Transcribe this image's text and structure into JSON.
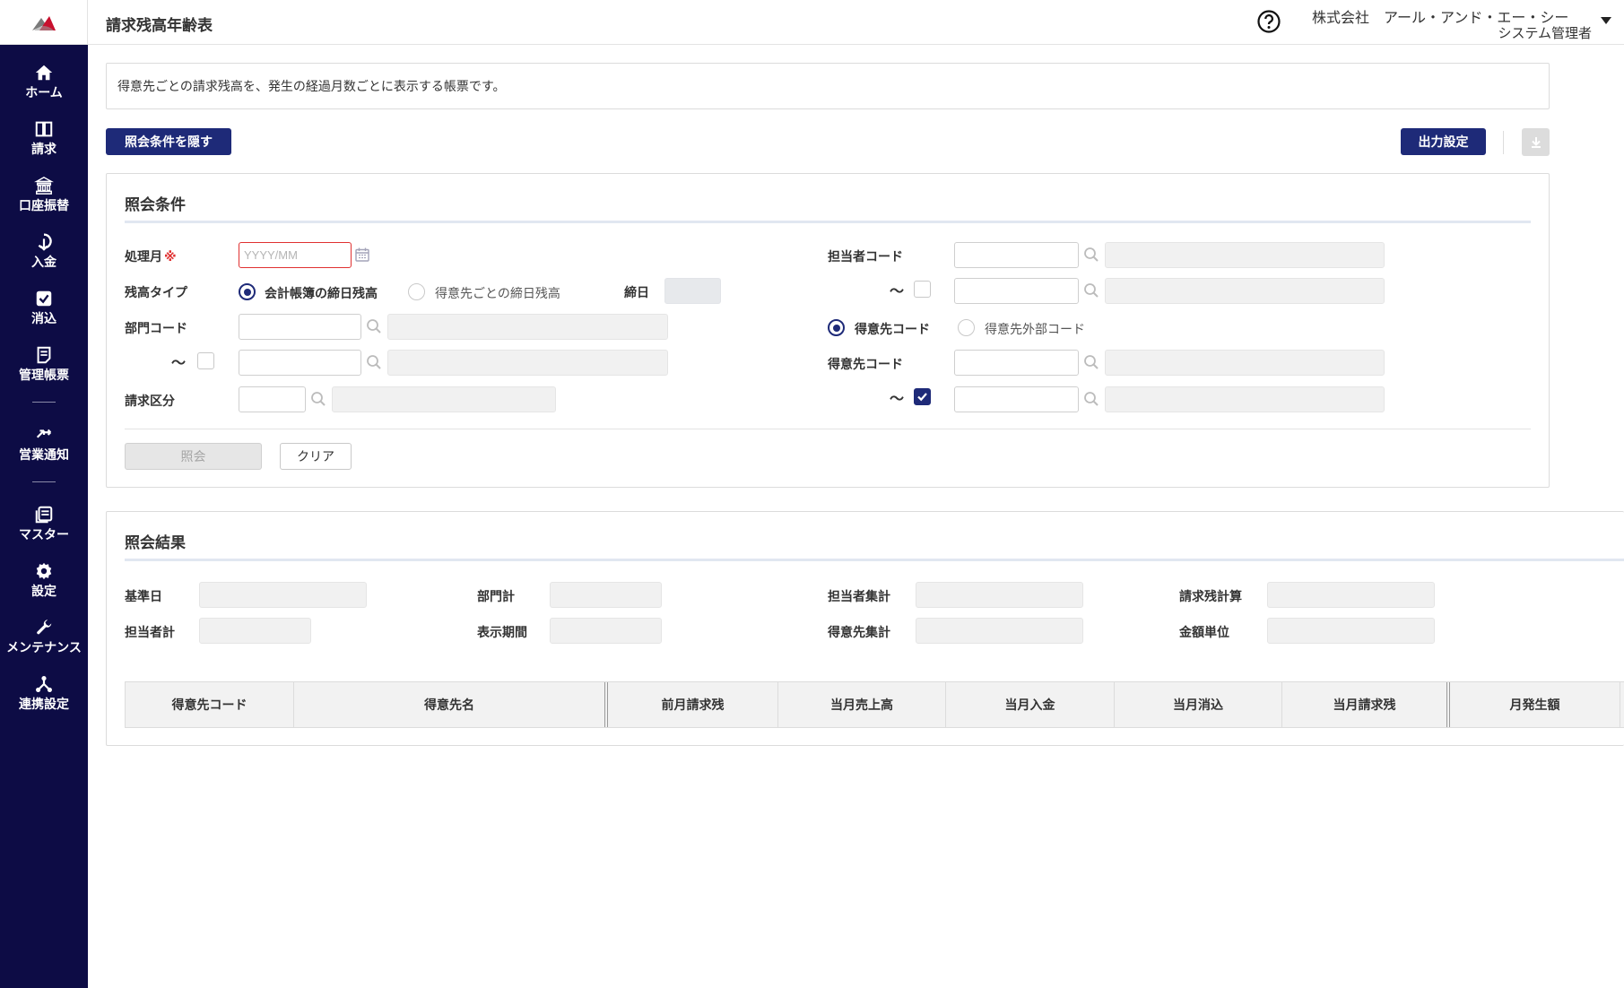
{
  "header": {
    "title": "請求残高年齢表",
    "company": "株式会社　アール・アンド・エー・シー",
    "user_role": "システム管理者"
  },
  "sidebar": {
    "items": [
      {
        "label": "ホーム",
        "icon": "home-icon"
      },
      {
        "label": "請求",
        "icon": "book-icon"
      },
      {
        "label": "口座振替",
        "icon": "bank-icon"
      },
      {
        "label": "入金",
        "icon": "deposit-icon"
      },
      {
        "label": "消込",
        "icon": "check-square-icon"
      },
      {
        "label": "管理帳票",
        "icon": "report-icon"
      },
      {
        "label": "営業通知",
        "icon": "arrows-exchange-icon"
      },
      {
        "label": "マスター",
        "icon": "master-list-icon"
      },
      {
        "label": "設定",
        "icon": "gear-icon"
      },
      {
        "label": "メンテナンス",
        "icon": "wrench-icon"
      },
      {
        "label": "連携設定",
        "icon": "network-icon"
      }
    ]
  },
  "description": "得意先ごとの請求残高を、発生の経過月数ごとに表示する帳票です。",
  "toolbar": {
    "hide_conditions": "照会条件を隠す",
    "output_settings": "出力設定"
  },
  "conditions": {
    "title": "照会条件",
    "month_label": "処理月",
    "required_mark": "※",
    "month_placeholder": "YYYY/MM",
    "balance_type_label": "残高タイプ",
    "balance_options": [
      "会計帳簿の締日残高",
      "得意先ごとの締日残高"
    ],
    "closing_day_label": "締日",
    "dept_code_label": "部門コード",
    "range_mark": "～",
    "billing_class_label": "請求区分",
    "staff_code_label": "担当者コード",
    "customer_code_type_options": [
      "得意先コード",
      "得意先外部コード"
    ],
    "customer_code_label": "得意先コード",
    "query_button": "照会",
    "clear_button": "クリア"
  },
  "results": {
    "title": "照会結果",
    "base_date_label": "基準日",
    "dept_total_label": "部門計",
    "staff_aggregate_label": "担当者集計",
    "billing_calc_label": "請求残計算",
    "staff_total_label": "担当者計",
    "display_period_label": "表示期間",
    "customer_aggregate_label": "得意先集計",
    "amount_unit_label": "金額単位",
    "columns": [
      "得意先コード",
      "得意先名",
      "前月請求残",
      "当月売上高",
      "当月入金",
      "当月消込",
      "当月請求残",
      "月発生額"
    ]
  },
  "colors": {
    "sidebar_bg": "#0d0c45",
    "primary": "#1e2a78",
    "required": "#e03131"
  }
}
